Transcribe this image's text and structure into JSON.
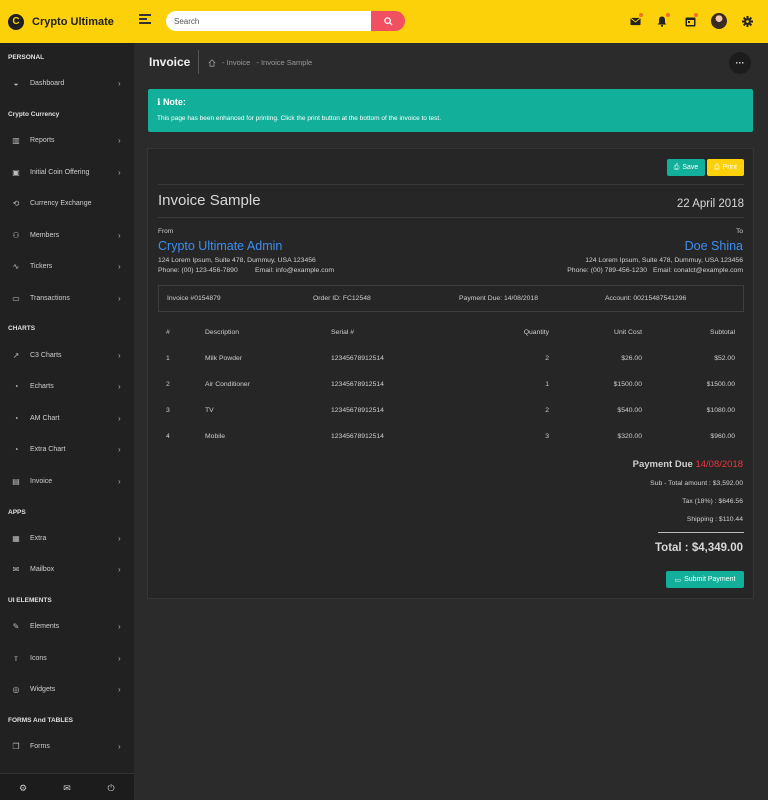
{
  "app": {
    "name": "Crypto Ultimate",
    "logo_letter": "C"
  },
  "search": {
    "placeholder": "Search"
  },
  "sidebar": {
    "sections": [
      {
        "title": "PERSONAL"
      },
      {
        "title": "Crypto Currency"
      },
      {
        "title": "CHARTS"
      },
      {
        "title": "APPS"
      },
      {
        "title": "UI ELEMENTS"
      },
      {
        "title": "FORMS And TABLES"
      }
    ],
    "items": [
      {
        "label": "Dashboard",
        "icon": "dashboard-icon"
      },
      {
        "label": "Reports",
        "icon": "bar-chart-icon"
      },
      {
        "label": "Initial Coin Offering",
        "icon": "coin-icon"
      },
      {
        "label": "Currency Exchange",
        "icon": "exchange-icon"
      },
      {
        "label": "Members",
        "icon": "user-icon"
      },
      {
        "label": "Tickers",
        "icon": "pulse-icon"
      },
      {
        "label": "Transactions",
        "icon": "wallet-icon"
      },
      {
        "label": "C3 Charts",
        "icon": "line-chart-icon"
      },
      {
        "label": "Echarts",
        "icon": "pie-chart-icon"
      },
      {
        "label": "AM Chart",
        "icon": "pie-chart-icon"
      },
      {
        "label": "Extra Chart",
        "icon": "pie-chart-icon"
      },
      {
        "label": "Invoice",
        "icon": "document-icon"
      },
      {
        "label": "Extra",
        "icon": "grid-icon"
      },
      {
        "label": "Mailbox",
        "icon": "mail-icon"
      },
      {
        "label": "Elements",
        "icon": "edit-icon"
      },
      {
        "label": "Icons",
        "icon": "text-icon"
      },
      {
        "label": "Widgets",
        "icon": "widget-icon"
      },
      {
        "label": "Forms",
        "icon": "copy-icon"
      }
    ]
  },
  "header": {
    "title": "Invoice",
    "breadcrumb": [
      "- Invoice",
      "- Invoice Sample"
    ]
  },
  "note": {
    "title": "Note:",
    "text": "This page has been enhanced for printing. Click the print button at the bottom of the invoice to test."
  },
  "invoice": {
    "save_label": "Save",
    "print_label": "Print",
    "title": "Invoice Sample",
    "date": "22 April 2018",
    "from": {
      "label": "From",
      "name": "Crypto Ultimate Admin",
      "address": "124 Lorem Ipsum, Suite 478, Dummuy, USA 123456",
      "phone": "Phone: (00) 123-456-7890",
      "email": "Email: info@example.com"
    },
    "to": {
      "label": "To",
      "name": "Doe Shina",
      "address": "124 Lorem Ipsum, Suite 478, Dummuy, USA 123456",
      "phone": "Phone: (00) 789-456-1230",
      "email": "Email: conatct@example.com"
    },
    "info": {
      "invoice_no": "Invoice #0154879",
      "order_id": "Order ID: FC12548",
      "payment_due": "Payment Due: 14/08/2018",
      "account": "Account: 00215487541296"
    },
    "table": {
      "headers": [
        "#",
        "Description",
        "Serial #",
        "Quantity",
        "Unit Cost",
        "Subtotal"
      ],
      "rows": [
        [
          "1",
          "Milk Powder",
          "12345678912514",
          "2",
          "$26.00",
          "$52.00"
        ],
        [
          "2",
          "Air Conditioner",
          "12345678912514",
          "1",
          "$1500.00",
          "$1500.00"
        ],
        [
          "3",
          "TV",
          "12345678912514",
          "2",
          "$540.00",
          "$1080.00"
        ],
        [
          "4",
          "Mobile",
          "12345678912514",
          "3",
          "$320.00",
          "$960.00"
        ]
      ]
    },
    "payment_due_label": "Payment Due",
    "payment_due_date": "14/08/2018",
    "subtotal": "Sub - Total amount : $3,592.00",
    "tax": "Tax (18%) : $646.56",
    "shipping": "Shipping : $110.44",
    "total": "Total : $4,349.00",
    "submit_label": "Submit Payment"
  },
  "colors": {
    "accent": "#fdd10a",
    "teal": "#12b09b",
    "link_blue": "#3d8ef1",
    "due_red": "#e9373f",
    "search_button": "#f0505f"
  }
}
